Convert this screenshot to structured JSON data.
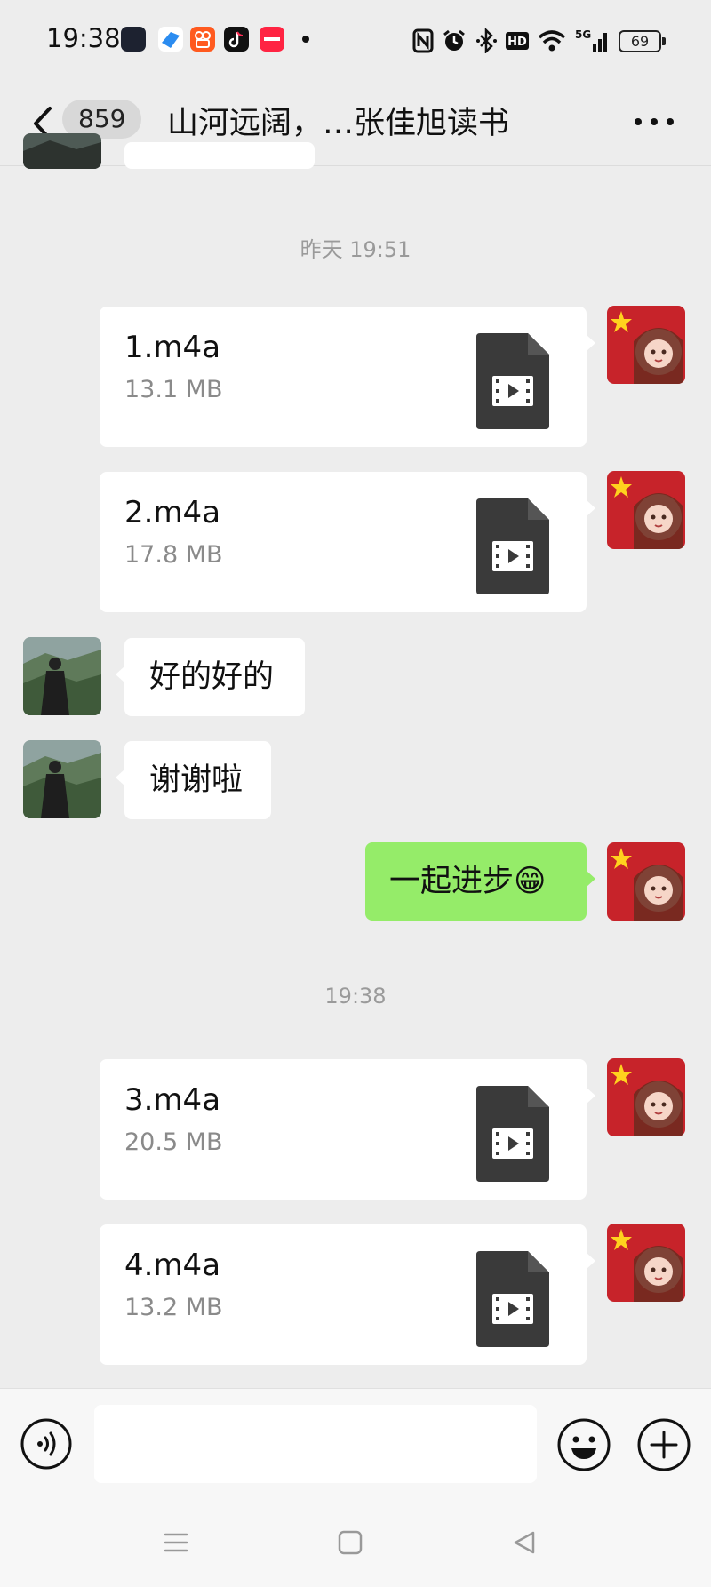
{
  "status_bar": {
    "time": "19:38",
    "app_icons": [
      "wechat-work-icon",
      "feishu-icon",
      "kuaishou-icon",
      "douyin-icon",
      "xiaohongshu-icon"
    ],
    "network": "5G",
    "battery": "69"
  },
  "header": {
    "unread_count": "859",
    "title": "山河远阔，…张佳旭读书"
  },
  "messages": [
    {
      "type": "timestamp",
      "text": "昨天 19:51"
    },
    {
      "type": "file",
      "side": "out",
      "name": "1.m4a",
      "size": "13.1 MB"
    },
    {
      "type": "file",
      "side": "out",
      "name": "2.m4a",
      "size": "17.8 MB"
    },
    {
      "type": "text",
      "side": "in",
      "text": "好的好的"
    },
    {
      "type": "text",
      "side": "in",
      "text": "谢谢啦"
    },
    {
      "type": "text",
      "side": "out",
      "text": "一起进步😁"
    },
    {
      "type": "timestamp",
      "text": "19:38"
    },
    {
      "type": "file",
      "side": "out",
      "name": "3.m4a",
      "size": "20.5 MB"
    },
    {
      "type": "file",
      "side": "out",
      "name": "4.m4a",
      "size": "13.2 MB"
    }
  ],
  "input": {
    "value": "",
    "placeholder": ""
  },
  "colors": {
    "background": "#ededed",
    "outgoing_bubble": "#95ec69",
    "incoming_bubble": "#ffffff",
    "file_icon": "#3a3a3a"
  }
}
